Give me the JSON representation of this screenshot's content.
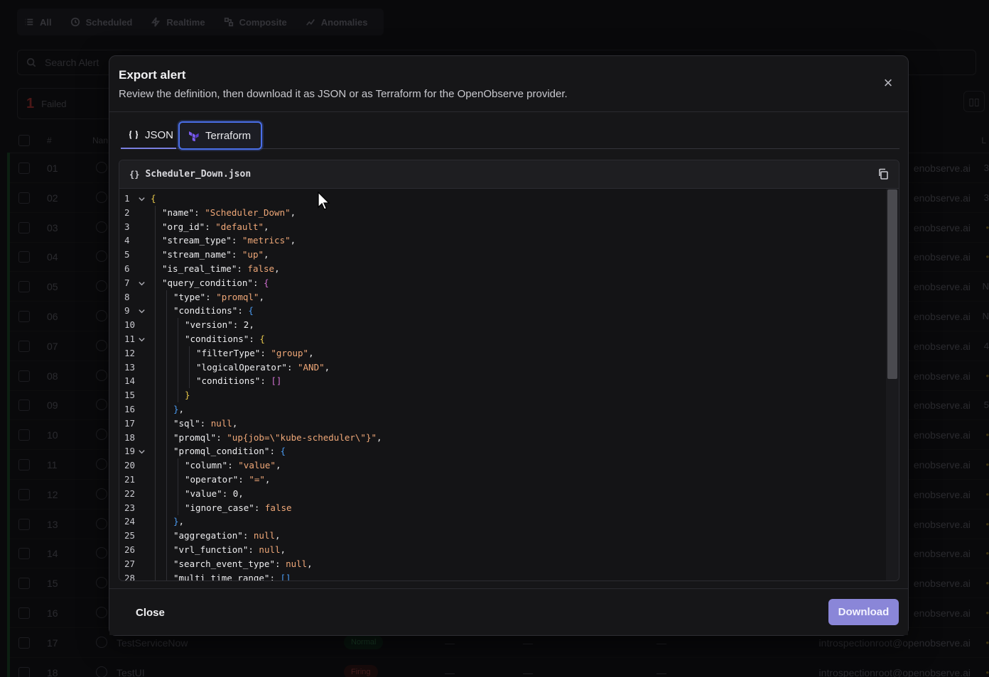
{
  "background": {
    "filters": [
      {
        "label": "All",
        "icon": "list-icon"
      },
      {
        "label": "Scheduled",
        "icon": "clock-icon"
      },
      {
        "label": "Realtime",
        "icon": "bolt-icon"
      },
      {
        "label": "Composite",
        "icon": "composite-icon"
      },
      {
        "label": "Anomalies",
        "icon": "anomaly-icon"
      }
    ],
    "search_placeholder": "Search Alert",
    "stat": {
      "count": "1",
      "label": "Failed"
    },
    "table_headers": {
      "num": "#",
      "name": "Nan",
      "last": "L"
    },
    "rows": [
      {
        "num": "01",
        "email": "enobserve.ai",
        "last": "3"
      },
      {
        "num": "02",
        "email": "enobserve.ai",
        "last": "3"
      },
      {
        "num": "03",
        "email": "enobserve.ai",
        "last": "•"
      },
      {
        "num": "04",
        "email": "enobserve.ai",
        "last": "•"
      },
      {
        "num": "05",
        "email": "enobserve.ai",
        "last": "N"
      },
      {
        "num": "06",
        "email": "enobserve.ai",
        "last": "N"
      },
      {
        "num": "07",
        "email": "enobserve.ai",
        "last": "4"
      },
      {
        "num": "08",
        "email": "enobserve.ai",
        "last": "•"
      },
      {
        "num": "09",
        "email": "enobserve.ai",
        "last": "5"
      },
      {
        "num": "10",
        "email": "enobserve.ai",
        "last": "•"
      },
      {
        "num": "11",
        "email": "enobserve.ai",
        "last": "•"
      },
      {
        "num": "12",
        "email": "enobserve.ai",
        "last": "•"
      },
      {
        "num": "13",
        "email": "enobserve.ai",
        "last": "•"
      },
      {
        "num": "14",
        "email": "enobserve.ai",
        "last": "•"
      },
      {
        "num": "15",
        "email": "enobserve.ai",
        "last": "•"
      },
      {
        "num": "16",
        "email": "enobserve.ai",
        "last": "•"
      },
      {
        "num": "17",
        "name": "TestServiceNow",
        "status": "Normal",
        "email": "introspectionroot@openobserve.ai",
        "last": "•"
      },
      {
        "num": "18",
        "name": "TestUI",
        "status": "Firing",
        "email": "introspectionroot@openobserve.ai",
        "last": "•"
      }
    ]
  },
  "modal": {
    "title": "Export alert",
    "description": "Review the definition, then download it as JSON or as Terraform for the OpenObserve provider.",
    "close_icon": "×",
    "tabs": {
      "json": "JSON",
      "terraform": "Terraform"
    },
    "file_name": "Scheduler_Down.json",
    "file_icon": "{}",
    "footer": {
      "close": "Close",
      "download": "Download"
    }
  },
  "code_lines": [
    {
      "n": "1",
      "fold": true,
      "indent": 0,
      "parts": [
        [
          "b1",
          "{"
        ]
      ]
    },
    {
      "n": "2",
      "indent": 1,
      "parts": [
        [
          "k",
          "\"name\""
        ],
        [
          "p",
          ": "
        ],
        [
          "s",
          "\"Scheduler_Down\""
        ],
        [
          "p",
          ","
        ]
      ]
    },
    {
      "n": "3",
      "indent": 1,
      "parts": [
        [
          "k",
          "\"org_id\""
        ],
        [
          "p",
          ": "
        ],
        [
          "s",
          "\"default\""
        ],
        [
          "p",
          ","
        ]
      ]
    },
    {
      "n": "4",
      "indent": 1,
      "parts": [
        [
          "k",
          "\"stream_type\""
        ],
        [
          "p",
          ": "
        ],
        [
          "s",
          "\"metrics\""
        ],
        [
          "p",
          ","
        ]
      ]
    },
    {
      "n": "5",
      "indent": 1,
      "parts": [
        [
          "k",
          "\"stream_name\""
        ],
        [
          "p",
          ": "
        ],
        [
          "s",
          "\"up\""
        ],
        [
          "p",
          ","
        ]
      ]
    },
    {
      "n": "6",
      "indent": 1,
      "parts": [
        [
          "k",
          "\"is_real_time\""
        ],
        [
          "p",
          ": "
        ],
        [
          "kw",
          "false"
        ],
        [
          "p",
          ","
        ]
      ]
    },
    {
      "n": "7",
      "fold": true,
      "indent": 1,
      "parts": [
        [
          "k",
          "\"query_condition\""
        ],
        [
          "p",
          ": "
        ],
        [
          "b2",
          "{"
        ]
      ]
    },
    {
      "n": "8",
      "indent": 2,
      "parts": [
        [
          "k",
          "\"type\""
        ],
        [
          "p",
          ": "
        ],
        [
          "s",
          "\"promql\""
        ],
        [
          "p",
          ","
        ]
      ]
    },
    {
      "n": "9",
      "fold": true,
      "indent": 2,
      "parts": [
        [
          "k",
          "\"conditions\""
        ],
        [
          "p",
          ": "
        ],
        [
          "b3",
          "{"
        ]
      ]
    },
    {
      "n": "10",
      "indent": 3,
      "parts": [
        [
          "k",
          "\"version\""
        ],
        [
          "p",
          ": "
        ],
        [
          "n",
          "2"
        ],
        [
          "p",
          ","
        ]
      ]
    },
    {
      "n": "11",
      "fold": true,
      "indent": 3,
      "parts": [
        [
          "k",
          "\"conditions\""
        ],
        [
          "p",
          ": "
        ],
        [
          "b1",
          "{"
        ]
      ]
    },
    {
      "n": "12",
      "indent": 4,
      "parts": [
        [
          "k",
          "\"filterType\""
        ],
        [
          "p",
          ": "
        ],
        [
          "s",
          "\"group\""
        ],
        [
          "p",
          ","
        ]
      ]
    },
    {
      "n": "13",
      "indent": 4,
      "parts": [
        [
          "k",
          "\"logicalOperator\""
        ],
        [
          "p",
          ": "
        ],
        [
          "s",
          "\"AND\""
        ],
        [
          "p",
          ","
        ]
      ]
    },
    {
      "n": "14",
      "indent": 4,
      "parts": [
        [
          "k",
          "\"conditions\""
        ],
        [
          "p",
          ": "
        ],
        [
          "b2",
          "[]"
        ]
      ]
    },
    {
      "n": "15",
      "indent": 3,
      "parts": [
        [
          "b1",
          "}"
        ]
      ]
    },
    {
      "n": "16",
      "indent": 2,
      "parts": [
        [
          "b3",
          "}"
        ],
        [
          "p",
          ","
        ]
      ]
    },
    {
      "n": "17",
      "indent": 2,
      "parts": [
        [
          "k",
          "\"sql\""
        ],
        [
          "p",
          ": "
        ],
        [
          "kw",
          "null"
        ],
        [
          "p",
          ","
        ]
      ]
    },
    {
      "n": "18",
      "indent": 2,
      "parts": [
        [
          "k",
          "\"promql\""
        ],
        [
          "p",
          ": "
        ],
        [
          "s",
          "\"up{job=\\\"kube-scheduler\\\"}\""
        ],
        [
          "p",
          ","
        ]
      ]
    },
    {
      "n": "19",
      "fold": true,
      "indent": 2,
      "parts": [
        [
          "k",
          "\"promql_condition\""
        ],
        [
          "p",
          ": "
        ],
        [
          "b3",
          "{"
        ]
      ]
    },
    {
      "n": "20",
      "indent": 3,
      "parts": [
        [
          "k",
          "\"column\""
        ],
        [
          "p",
          ": "
        ],
        [
          "s",
          "\"value\""
        ],
        [
          "p",
          ","
        ]
      ]
    },
    {
      "n": "21",
      "indent": 3,
      "parts": [
        [
          "k",
          "\"operator\""
        ],
        [
          "p",
          ": "
        ],
        [
          "s",
          "\"=\""
        ],
        [
          "p",
          ","
        ]
      ]
    },
    {
      "n": "22",
      "indent": 3,
      "parts": [
        [
          "k",
          "\"value\""
        ],
        [
          "p",
          ": "
        ],
        [
          "n",
          "0"
        ],
        [
          "p",
          ","
        ]
      ]
    },
    {
      "n": "23",
      "indent": 3,
      "parts": [
        [
          "k",
          "\"ignore_case\""
        ],
        [
          "p",
          ": "
        ],
        [
          "kw",
          "false"
        ]
      ]
    },
    {
      "n": "24",
      "indent": 2,
      "parts": [
        [
          "b3",
          "}"
        ],
        [
          "p",
          ","
        ]
      ]
    },
    {
      "n": "25",
      "indent": 2,
      "parts": [
        [
          "k",
          "\"aggregation\""
        ],
        [
          "p",
          ": "
        ],
        [
          "kw",
          "null"
        ],
        [
          "p",
          ","
        ]
      ]
    },
    {
      "n": "26",
      "indent": 2,
      "parts": [
        [
          "k",
          "\"vrl_function\""
        ],
        [
          "p",
          ": "
        ],
        [
          "kw",
          "null"
        ],
        [
          "p",
          ","
        ]
      ]
    },
    {
      "n": "27",
      "indent": 2,
      "parts": [
        [
          "k",
          "\"search_event_type\""
        ],
        [
          "p",
          ": "
        ],
        [
          "kw",
          "null"
        ],
        [
          "p",
          ","
        ]
      ]
    },
    {
      "n": "28",
      "indent": 2,
      "parts": [
        [
          "k",
          "\"multi_time_range\""
        ],
        [
          "p",
          ": "
        ],
        [
          "b3",
          "[]"
        ]
      ]
    }
  ],
  "colors": {
    "accent": "#8a86d8",
    "tab_focus": "#4a6fe8"
  }
}
